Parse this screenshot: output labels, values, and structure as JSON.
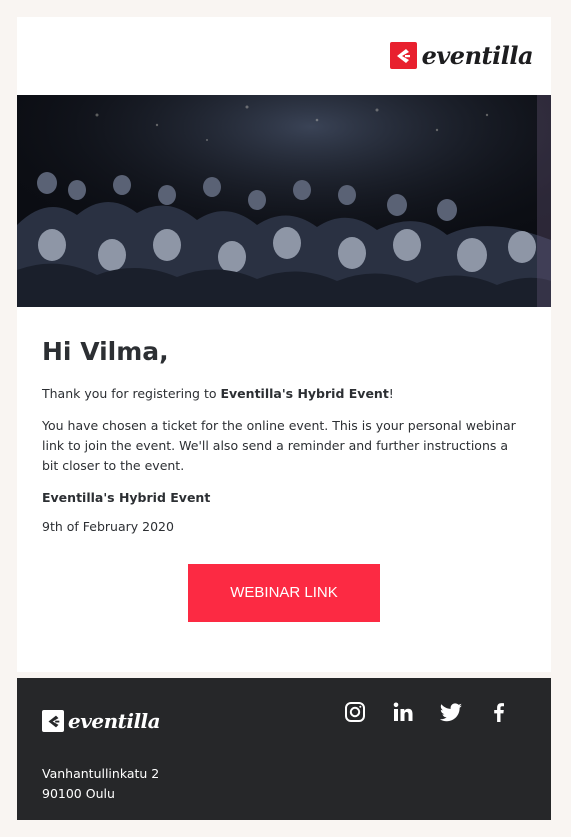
{
  "brand": {
    "name": "eventilla",
    "accent": "#e8202e"
  },
  "hero": {
    "icon": "audience-photo"
  },
  "content": {
    "greeting": "Hi Vilma,",
    "thanks_prefix": "Thank you for registering to ",
    "thanks_event": "Eventilla's Hybrid Event",
    "thanks_suffix": "!",
    "body": "You have chosen a ticket for the online event. This is your personal webinar link to join the event. We'll also send a reminder and further instructions a bit closer to the event.",
    "event_title": "Eventilla's Hybrid Event",
    "event_date": "9th of February 2020",
    "button_label": "WEBINAR LINK",
    "button_color": "#fc2a43"
  },
  "footer": {
    "brand_name": "eventilla",
    "address_line1": "Vanhantullinkatu 2",
    "address_line2": "90100 Oulu",
    "social": [
      "instagram-icon",
      "linkedin-icon",
      "twitter-icon",
      "facebook-icon"
    ],
    "background": "#262729"
  }
}
